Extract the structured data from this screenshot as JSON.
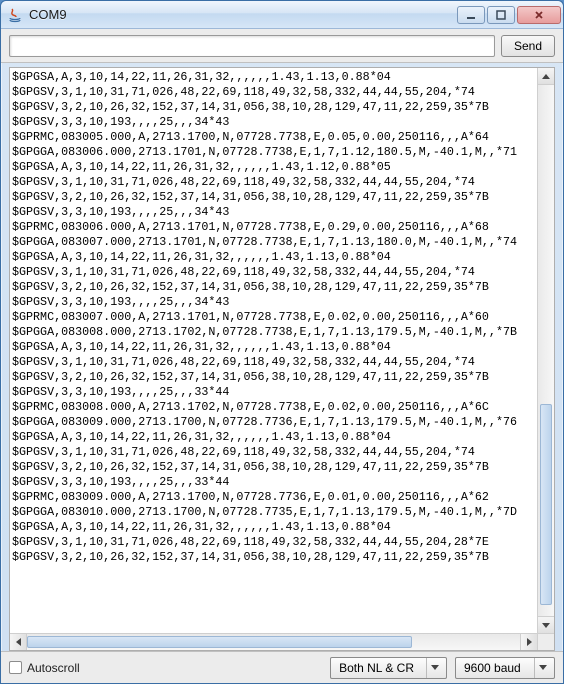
{
  "title": "COM9",
  "toolbar": {
    "input_value": "",
    "input_placeholder": "",
    "send_label": "Send"
  },
  "terminal": {
    "lines": [
      "$GPGSA,A,3,10,14,22,11,26,31,32,,,,,,1.43,1.13,0.88*04",
      "$GPGSV,3,1,10,31,71,026,48,22,69,118,49,32,58,332,44,44,55,204,*74",
      "$GPGSV,3,2,10,26,32,152,37,14,31,056,38,10,28,129,47,11,22,259,35*7B",
      "$GPGSV,3,3,10,193,,,,25,,,34*43",
      "$GPRMC,083005.000,A,2713.1700,N,07728.7738,E,0.05,0.00,250116,,,A*64",
      "$GPGGA,083006.000,2713.1701,N,07728.7738,E,1,7,1.12,180.5,M,-40.1,M,,*71",
      "$GPGSA,A,3,10,14,22,11,26,31,32,,,,,,1.43,1.12,0.88*05",
      "$GPGSV,3,1,10,31,71,026,48,22,69,118,49,32,58,332,44,44,55,204,*74",
      "$GPGSV,3,2,10,26,32,152,37,14,31,056,38,10,28,129,47,11,22,259,35*7B",
      "$GPGSV,3,3,10,193,,,,25,,,34*43",
      "$GPRMC,083006.000,A,2713.1701,N,07728.7738,E,0.29,0.00,250116,,,A*68",
      "$GPGGA,083007.000,2713.1701,N,07728.7738,E,1,7,1.13,180.0,M,-40.1,M,,*74",
      "$GPGSA,A,3,10,14,22,11,26,31,32,,,,,,1.43,1.13,0.88*04",
      "$GPGSV,3,1,10,31,71,026,48,22,69,118,49,32,58,332,44,44,55,204,*74",
      "$GPGSV,3,2,10,26,32,152,37,14,31,056,38,10,28,129,47,11,22,259,35*7B",
      "$GPGSV,3,3,10,193,,,,25,,,34*43",
      "$GPRMC,083007.000,A,2713.1701,N,07728.7738,E,0.02,0.00,250116,,,A*60",
      "$GPGGA,083008.000,2713.1702,N,07728.7738,E,1,7,1.13,179.5,M,-40.1,M,,*7B",
      "$GPGSA,A,3,10,14,22,11,26,31,32,,,,,,1.43,1.13,0.88*04",
      "$GPGSV,3,1,10,31,71,026,48,22,69,118,49,32,58,332,44,44,55,204,*74",
      "$GPGSV,3,2,10,26,32,152,37,14,31,056,38,10,28,129,47,11,22,259,35*7B",
      "$GPGSV,3,3,10,193,,,,25,,,33*44",
      "$GPRMC,083008.000,A,2713.1702,N,07728.7738,E,0.02,0.00,250116,,,A*6C",
      "$GPGGA,083009.000,2713.1700,N,07728.7736,E,1,7,1.13,179.5,M,-40.1,M,,*76",
      "$GPGSA,A,3,10,14,22,11,26,31,32,,,,,,1.43,1.13,0.88*04",
      "$GPGSV,3,1,10,31,71,026,48,22,69,118,49,32,58,332,44,44,55,204,*74",
      "$GPGSV,3,2,10,26,32,152,37,14,31,056,38,10,28,129,47,11,22,259,35*7B",
      "$GPGSV,3,3,10,193,,,,25,,,33*44",
      "$GPRMC,083009.000,A,2713.1700,N,07728.7736,E,0.01,0.00,250116,,,A*62",
      "$GPGGA,083010.000,2713.1700,N,07728.7735,E,1,7,1.13,179.5,M,-40.1,M,,*7D",
      "$GPGSA,A,3,10,14,22,11,26,31,32,,,,,,1.43,1.13,0.88*04",
      "$GPGSV,3,1,10,31,71,026,48,22,69,118,49,32,58,332,44,44,55,204,28*7E",
      "$GPGSV,3,2,10,26,32,152,37,14,31,056,38,10,28,129,47,11,22,259,35*7B"
    ]
  },
  "statusbar": {
    "autoscroll_label": "Autoscroll",
    "line_ending": "Both NL & CR",
    "baud": "9600 baud"
  }
}
